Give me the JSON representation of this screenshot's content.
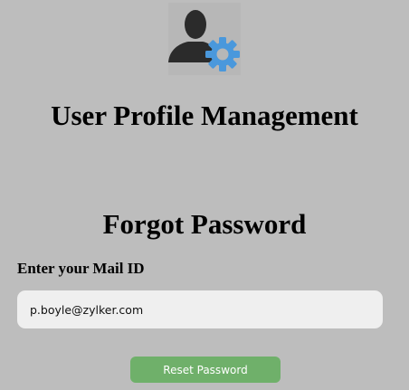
{
  "header": {
    "logo_icon": "user-gear-icon",
    "app_title": "User Profile Management"
  },
  "form": {
    "title": "Forgot Password",
    "mail_label": "Enter your Mail ID",
    "mail_value": "p.boyle@zylker.com",
    "reset_label": "Reset Password"
  },
  "colors": {
    "background": "#bdbdbd",
    "user_icon": "#2b2b2b",
    "gear_icon": "#4a98dc",
    "input_background": "#efefef",
    "button": "#6fb06a",
    "button_text": "#ffffff"
  }
}
